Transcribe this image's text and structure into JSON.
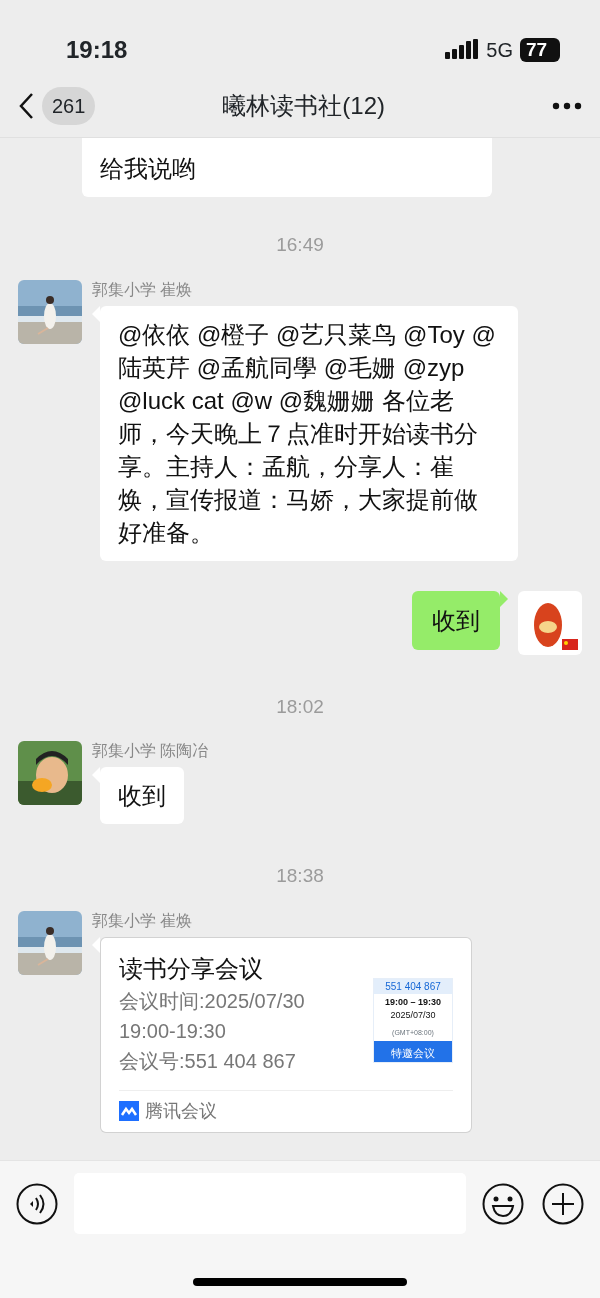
{
  "status_bar": {
    "time": "19:18",
    "network": "5G",
    "battery": "77"
  },
  "header": {
    "back_count": "261",
    "title": "曦林读书社(12)"
  },
  "messages": [
    {
      "kind": "text",
      "outgoing": false,
      "clipped": true,
      "text": "给我说哟"
    },
    {
      "kind": "time",
      "text": "16:49"
    },
    {
      "kind": "text",
      "outgoing": false,
      "sender": "郭集小学 崔焕",
      "text": "@依依 @橙子 @艺只菜鸟 @Toy @陆英芹 @孟航同學 @毛姗 @zyp @luck  cat @w @魏姗姗 各位老师，今天晚上７点准时开始读书分享。主持人：孟航，分享人：崔焕，宣传报道：马娇，大家提前做好准备。"
    },
    {
      "kind": "text",
      "outgoing": true,
      "text": "收到"
    },
    {
      "kind": "time",
      "text": "18:02"
    },
    {
      "kind": "text",
      "outgoing": false,
      "sender": "郭集小学 陈陶冶",
      "text": "收到"
    },
    {
      "kind": "time",
      "text": "18:38"
    },
    {
      "kind": "meeting",
      "sender": "郭集小学 崔焕",
      "title": "读书分享会议",
      "lines": [
        "会议时间:2025/07/30",
        "19:00-19:30",
        "会议号:551 404 867"
      ],
      "thumb": {
        "number": "551 404 867",
        "time": "19:00 – 19:30",
        "date": "2025/07/30",
        "zone": "(GMT+08:00)",
        "label": "特邀会议"
      },
      "app": "腾讯会议"
    }
  ]
}
